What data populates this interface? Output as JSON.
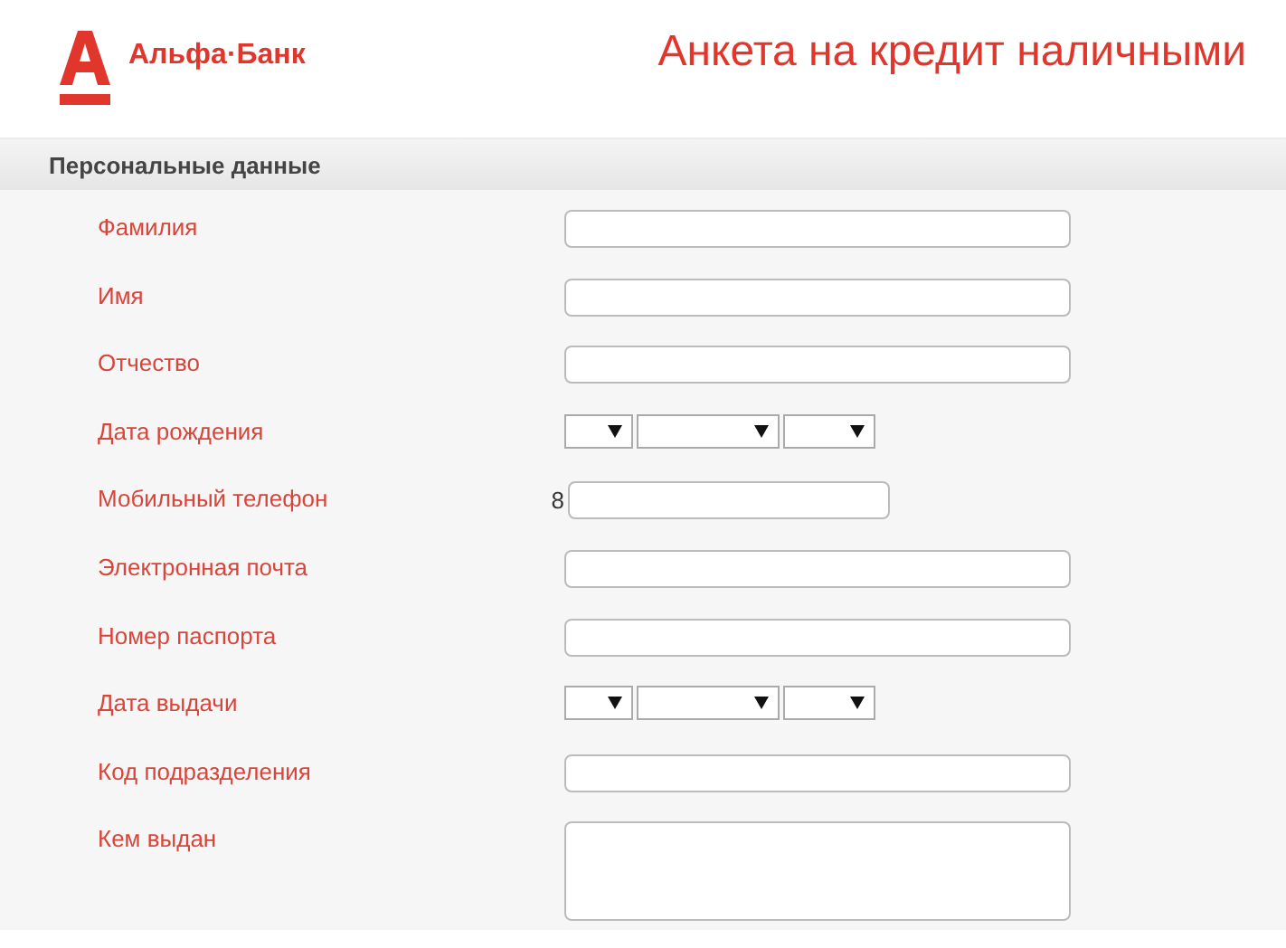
{
  "header": {
    "bank_name": "Альфа·Банк",
    "title": "Анкета на кредит наличными"
  },
  "section": {
    "title": "Персональные данные"
  },
  "fields": [
    {
      "label": "Фамилия",
      "kind": "text"
    },
    {
      "label": "Имя",
      "kind": "text"
    },
    {
      "label": "Отчество",
      "kind": "text"
    },
    {
      "label": "Дата рождения",
      "kind": "date"
    },
    {
      "label": "Мобильный телефон",
      "kind": "phone",
      "prefix": "8"
    },
    {
      "label": "Электронная почта",
      "kind": "text"
    },
    {
      "label": "Номер паспорта",
      "kind": "text"
    },
    {
      "label": "Дата выдачи",
      "kind": "date"
    },
    {
      "label": "Код подразделения",
      "kind": "text"
    },
    {
      "label": "Кем выдан",
      "kind": "textarea"
    }
  ]
}
